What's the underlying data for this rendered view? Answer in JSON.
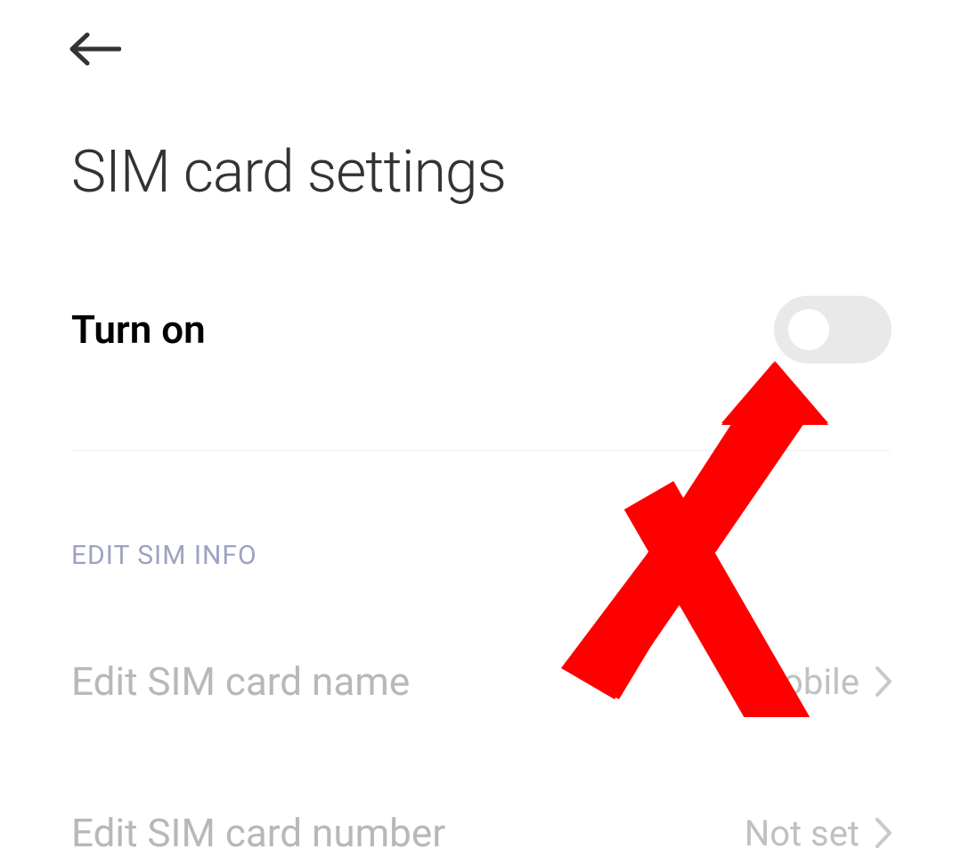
{
  "header": {
    "title": "SIM card settings"
  },
  "turn_on": {
    "label": "Turn on",
    "enabled": false
  },
  "section": {
    "header": "EDIT SIM INFO",
    "items": [
      {
        "label": "Edit SIM card name",
        "value": "9Mobile"
      },
      {
        "label": "Edit SIM card number",
        "value": "Not set"
      }
    ]
  },
  "annotation": {
    "type": "arrow",
    "color": "#ff0000"
  }
}
